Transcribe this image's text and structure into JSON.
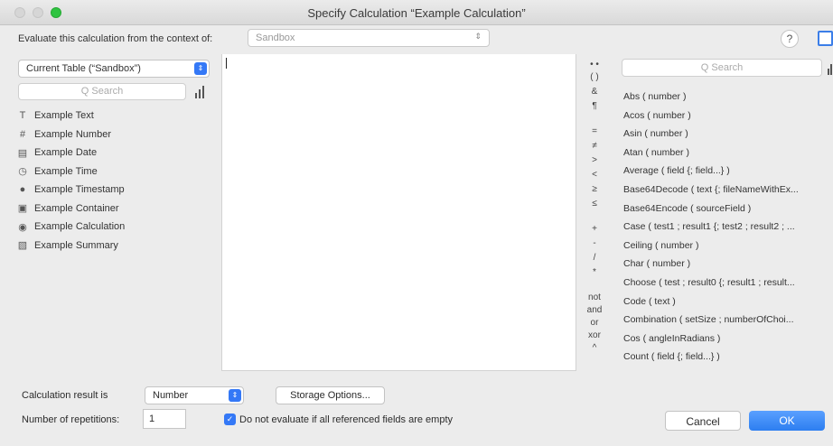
{
  "window": {
    "title": "Specify Calculation “Example Calculation”"
  },
  "context": {
    "label": "Evaluate this calculation from the context of:",
    "value": "Sandbox",
    "help": "?"
  },
  "table_selector": {
    "value": "Current Table (“Sandbox”)"
  },
  "field_search": {
    "placeholder": "Q Search"
  },
  "fields": [
    {
      "name": "Example Text",
      "icon": "T"
    },
    {
      "name": "Example Number",
      "icon": "#"
    },
    {
      "name": "Example Date",
      "icon": "▤"
    },
    {
      "name": "Example Time",
      "icon": "◷"
    },
    {
      "name": "Example Timestamp",
      "icon": "●"
    },
    {
      "name": "Example Container",
      "icon": "▣"
    },
    {
      "name": "Example Calculation",
      "icon": "◉"
    },
    {
      "name": "Example Summary",
      "icon": "▧"
    }
  ],
  "operators": [
    "• •",
    "( )",
    "&",
    "¶",
    "=",
    "≠",
    ">",
    "<",
    "≥",
    "≤",
    "+",
    "-",
    "/",
    "*",
    "not",
    "and",
    "or",
    "xor",
    "^"
  ],
  "function_search": {
    "placeholder": "Q Search"
  },
  "functions": [
    "Abs ( number )",
    "Acos ( number )",
    "Asin ( number )",
    "Atan ( number )",
    "Average ( field {; field...} )",
    "Base64Decode ( text {; fileNameWithEx...",
    "Base64Encode ( sourceField )",
    "Case ( test1 ; result1 {; test2 ; result2 ; ...",
    "Ceiling ( number )",
    "Char ( number )",
    "Choose ( test ; result0 {; result1 ; result...",
    "Code ( text )",
    "Combination ( setSize ; numberOfChoi...",
    "Cos ( angleInRadians )",
    "Count ( field {; field...} )"
  ],
  "result": {
    "label": "Calculation result is",
    "value": "Number"
  },
  "storage_button": "Storage Options...",
  "repetitions": {
    "label": "Number of repetitions:",
    "value": "1"
  },
  "no_eval": {
    "label": "Do not evaluate if all referenced fields are empty",
    "checked": true
  },
  "buttons": {
    "cancel": "Cancel",
    "ok": "OK"
  }
}
